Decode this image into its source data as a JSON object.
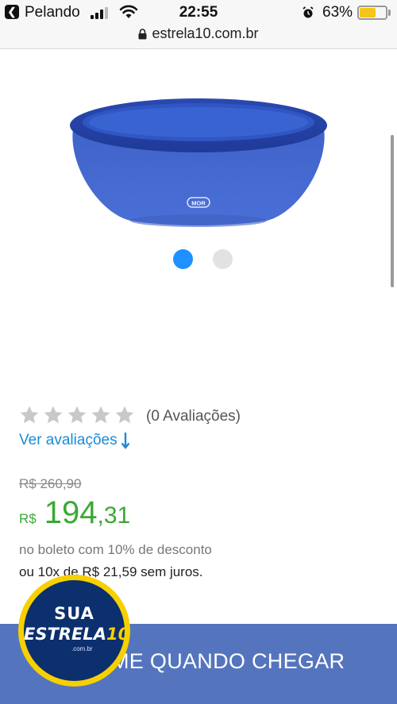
{
  "status_bar": {
    "back_label": "Pelando",
    "time": "22:55",
    "battery_percent_label": "63%",
    "battery_level": 0.63
  },
  "url_bar": {
    "url": "estrela10.com.br"
  },
  "product": {
    "brand_mark": "MOR",
    "carousel": {
      "total": 2,
      "active_index": 0
    }
  },
  "rating": {
    "stars_filled": 0,
    "stars_total": 5,
    "reviews_count_label": "(0 Avaliações)",
    "see_reviews_label": "Ver avaliações"
  },
  "price": {
    "old_price": "R$ 260,90",
    "currency": "R$",
    "integer": "194",
    "decimal": ",31",
    "boleto_text": "no boleto com 10% de desconto",
    "installments_text": "ou 10x de R$ 21,59 sem juros."
  },
  "notify": {
    "label": "ME QUANDO CHEGAR"
  },
  "badge": {
    "line1": "SUA",
    "line2_word": "ESTRELA",
    "line2_number": "10",
    "line3": ".com.br"
  },
  "colors": {
    "price_green": "#3aa935",
    "link_blue": "#1b8ad6",
    "notify_bar": "#5475be",
    "dot_active": "#1e90ff",
    "badge_yellow": "#f7d000",
    "badge_navy": "#0c2f6e"
  },
  "icons": {
    "back": "back-arrow-icon",
    "signal": "signal-bars-icon",
    "wifi": "wifi-icon",
    "alarm": "alarm-icon",
    "battery": "battery-icon",
    "lock": "lock-icon",
    "star": "star-icon",
    "arrow": "arrow-down-icon"
  }
}
